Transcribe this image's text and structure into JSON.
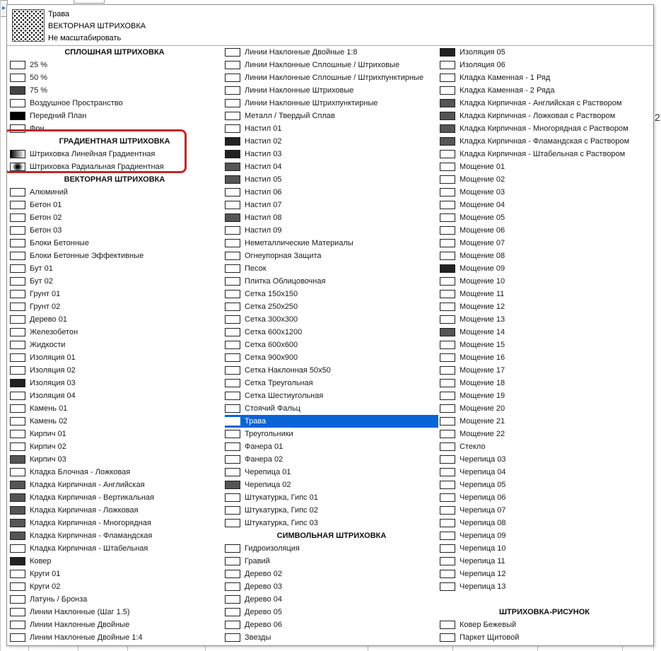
{
  "preview": {
    "name": "Трава",
    "type": "ВЕКТОРНАЯ ШТРИХОВКА",
    "scale": "Не масштабировать"
  },
  "background": {
    "right_edge_number": "2",
    "left_tab_glyph": "▸"
  },
  "highlight_color": "#c0292b",
  "selection_color": "#0a64d6",
  "columns": [
    {
      "items": [
        {
          "kind": "header",
          "label": "СПЛОШНАЯ ШТРИХОВКА"
        },
        {
          "label": "25 %",
          "pattern": "p-25"
        },
        {
          "label": "50 %",
          "pattern": "p-50"
        },
        {
          "label": "75 %",
          "pattern": "p-75"
        },
        {
          "label": "Воздушное Пространство",
          "pattern": "p-empty"
        },
        {
          "label": "Передний План",
          "pattern": "p-solid"
        },
        {
          "label": "Фон",
          "pattern": "p-empty"
        },
        {
          "kind": "header",
          "label": "ГРАДИЕНТНАЯ ШТРИХОВКА"
        },
        {
          "label": "Штриховка Линейная Градиентная",
          "pattern": "p-lingrad"
        },
        {
          "label": "Штриховка Радиальная Градиентная",
          "pattern": "p-radgrad"
        },
        {
          "kind": "header",
          "label": "ВЕКТОРНАЯ ШТРИХОВКА"
        },
        {
          "label": "Алюминий",
          "pattern": "p-diag"
        },
        {
          "label": "Бетон 01",
          "pattern": "p-dots"
        },
        {
          "label": "Бетон 02",
          "pattern": "p-dots"
        },
        {
          "label": "Бетон 03",
          "pattern": "p-star"
        },
        {
          "label": "Блоки Бетонные",
          "pattern": "p-cross"
        },
        {
          "label": "Блоки Бетонные Эффективные",
          "pattern": "p-cross"
        },
        {
          "label": "Бут 01",
          "pattern": "p-wave"
        },
        {
          "label": "Бут 02",
          "pattern": "p-wave"
        },
        {
          "label": "Грунт 01",
          "pattern": "p-diag"
        },
        {
          "label": "Грунт 02",
          "pattern": "p-diag"
        },
        {
          "label": "Дерево 01",
          "pattern": "p-diag2"
        },
        {
          "label": "Железобетон",
          "pattern": "p-diag"
        },
        {
          "label": "Жидкости",
          "pattern": "p-dots"
        },
        {
          "label": "Изоляция 01",
          "pattern": "p-cross"
        },
        {
          "label": "Изоляция 02",
          "pattern": "p-diag"
        },
        {
          "label": "Изоляция 03",
          "pattern": "p-dark"
        },
        {
          "label": "Изоляция 04",
          "pattern": "p-wave"
        },
        {
          "label": "Камень 01",
          "pattern": "p-dots"
        },
        {
          "label": "Камень 02",
          "pattern": "p-dots"
        },
        {
          "label": "Кирпич 01",
          "pattern": "p-diag"
        },
        {
          "label": "Кирпич 02",
          "pattern": "p-diag"
        },
        {
          "label": "Кирпич 03",
          "pattern": "p-brick"
        },
        {
          "label": "Кладка Блочная - Ложковая",
          "pattern": "p-hlines"
        },
        {
          "label": "Кладка Кирпичная - Английская",
          "pattern": "p-brick"
        },
        {
          "label": "Кладка Кирпичная - Вертикальная",
          "pattern": "p-brick"
        },
        {
          "label": "Кладка Кирпичная - Ложковая",
          "pattern": "p-brick"
        },
        {
          "label": "Кладка Кирпичная - Многорядная",
          "pattern": "p-brick"
        },
        {
          "label": "Кладка Кирпичная - Фламандская",
          "pattern": "p-brick"
        },
        {
          "label": "Кладка Кирпичная - Штабельная",
          "pattern": "p-grid"
        },
        {
          "label": "Ковер",
          "pattern": "p-dark"
        },
        {
          "label": "Круги 01",
          "pattern": "p-circles"
        },
        {
          "label": "Круги 02",
          "pattern": "p-check"
        },
        {
          "label": "Латунь / Бронза",
          "pattern": "p-diag"
        },
        {
          "label": "Линии Наклонные (Шаг 1.5)",
          "pattern": "p-diag"
        },
        {
          "label": "Линии Наклонные Двойные",
          "pattern": "p-diag"
        },
        {
          "label": "Линии Наклонные Двойные 1:4",
          "pattern": "p-diag"
        }
      ]
    },
    {
      "items": [
        {
          "label": "Линии Наклонные Двойные 1:8",
          "pattern": "p-diag"
        },
        {
          "label": "Линии Наклонные Сплошные / Штриховые",
          "pattern": "p-diag"
        },
        {
          "label": "Линии Наклонные Сплошные / Штрихпунктирные",
          "pattern": "p-diag"
        },
        {
          "label": "Линии Наклонные Штриховые",
          "pattern": "p-diag"
        },
        {
          "label": "Линии Наклонные Штрихпунктирные",
          "pattern": "p-diag"
        },
        {
          "label": "Металл / Твердый Сплав",
          "pattern": "p-diag"
        },
        {
          "label": "Настил 01",
          "pattern": "p-hlines"
        },
        {
          "label": "Настил 02",
          "pattern": "p-dark"
        },
        {
          "label": "Настил 03",
          "pattern": "p-dark"
        },
        {
          "label": "Настил 04",
          "pattern": "p-brick"
        },
        {
          "label": "Настил 05",
          "pattern": "p-brick"
        },
        {
          "label": "Настил 06",
          "pattern": "p-tile"
        },
        {
          "label": "Настил 07",
          "pattern": "p-check"
        },
        {
          "label": "Настил 08",
          "pattern": "p-brick"
        },
        {
          "label": "Настил 09",
          "pattern": "p-zig"
        },
        {
          "label": "Неметаллические Материалы",
          "pattern": "p-diag"
        },
        {
          "label": "Огнеупорная Защита",
          "pattern": "p-cross"
        },
        {
          "label": "Песок",
          "pattern": "p-dots"
        },
        {
          "label": "Плитка Облицовочная",
          "pattern": "p-dots"
        },
        {
          "label": "Сетка 150x150",
          "pattern": "p-tile"
        },
        {
          "label": "Сетка 250x250",
          "pattern": "p-tile"
        },
        {
          "label": "Сетка 300x300",
          "pattern": "p-tile"
        },
        {
          "label": "Сетка 600x1200",
          "pattern": "p-grid"
        },
        {
          "label": "Сетка 600x600",
          "pattern": "p-tile"
        },
        {
          "label": "Сетка 900x900",
          "pattern": "p-tile"
        },
        {
          "label": "Сетка Наклонная 50x50",
          "pattern": "p-cross"
        },
        {
          "label": "Сетка Треугольная",
          "pattern": "p-zig"
        },
        {
          "label": "Сетка Шестиугольная",
          "pattern": "p-circles"
        },
        {
          "label": "Стоячий Фальц",
          "pattern": "p-diag"
        },
        {
          "label": "Трава",
          "pattern": "p-star",
          "selected": true
        },
        {
          "label": "Треугольники",
          "pattern": "p-zig"
        },
        {
          "label": "Фанера 01",
          "pattern": "p-hlines"
        },
        {
          "label": "Фанера 02",
          "pattern": "p-wave"
        },
        {
          "label": "Черепица 01",
          "pattern": "p-wave"
        },
        {
          "label": "Черепица 02",
          "pattern": "p-brick"
        },
        {
          "label": "Штукатурка, Гипс 01",
          "pattern": "p-dots"
        },
        {
          "label": "Штукатурка, Гипс 02",
          "pattern": "p-dots"
        },
        {
          "label": "Штукатурка, Гипс 03",
          "pattern": "p-dots"
        },
        {
          "kind": "header",
          "label": "СИМВОЛЬНАЯ ШТРИХОВКА"
        },
        {
          "label": "Гидроизоляция",
          "pattern": "p-heavy"
        },
        {
          "label": "Гравий",
          "pattern": "p-circles"
        },
        {
          "label": "Дерево 02",
          "pattern": "p-diag"
        },
        {
          "label": "Дерево 03",
          "pattern": "p-diag"
        },
        {
          "label": "Дерево 04",
          "pattern": "p-wave"
        },
        {
          "label": "Дерево 05",
          "pattern": "p-wave"
        },
        {
          "label": "Дерево 06",
          "pattern": "p-wave"
        },
        {
          "label": "Звезды",
          "pattern": "p-star"
        }
      ]
    },
    {
      "items": [
        {
          "label": "Изоляция 05",
          "pattern": "p-dark"
        },
        {
          "label": "Изоляция 06",
          "pattern": "p-wave"
        },
        {
          "label": "Кладка Каменная - 1 Ряд",
          "pattern": "p-hlines"
        },
        {
          "label": "Кладка Каменная - 2 Ряда",
          "pattern": "p-hlines"
        },
        {
          "label": "Кладка Кирпичная - Английская с Раствором",
          "pattern": "p-brick"
        },
        {
          "label": "Кладка Кирпичная - Ложковая с Раствором",
          "pattern": "p-brick"
        },
        {
          "label": "Кладка Кирпичная - Многорядная с Раствором",
          "pattern": "p-brick"
        },
        {
          "label": "Кладка Кирпичная - Фламандская с Раствором",
          "pattern": "p-brick"
        },
        {
          "label": "Кладка Кирпичная - Штабельная с Раствором",
          "pattern": "p-grid"
        },
        {
          "label": "Мощение 01",
          "pattern": "p-tile"
        },
        {
          "label": "Мощение 02",
          "pattern": "p-tile"
        },
        {
          "label": "Мощение 03",
          "pattern": "p-zig"
        },
        {
          "label": "Мощение 04",
          "pattern": "p-circles"
        },
        {
          "label": "Мощение 05",
          "pattern": "p-tile"
        },
        {
          "label": "Мощение 06",
          "pattern": "p-tile"
        },
        {
          "label": "Мощение 07",
          "pattern": "p-bigcross"
        },
        {
          "label": "Мощение 08",
          "pattern": "p-tile"
        },
        {
          "label": "Мощение 09",
          "pattern": "p-dark"
        },
        {
          "label": "Мощение 10",
          "pattern": "p-check"
        },
        {
          "label": "Мощение 11",
          "pattern": "p-tile"
        },
        {
          "label": "Мощение 12",
          "pattern": "p-tile"
        },
        {
          "label": "Мощение 13",
          "pattern": "p-tile"
        },
        {
          "label": "Мощение 14",
          "pattern": "p-brick"
        },
        {
          "label": "Мощение 15",
          "pattern": "p-bigcross"
        },
        {
          "label": "Мощение 16",
          "pattern": "p-tile"
        },
        {
          "label": "Мощение 17",
          "pattern": "p-vlines"
        },
        {
          "label": "Мощение 18",
          "pattern": "p-wave"
        },
        {
          "label": "Мощение 19",
          "pattern": "p-tile"
        },
        {
          "label": "Мощение 20",
          "pattern": "p-tile"
        },
        {
          "label": "Мощение 21",
          "pattern": "p-check"
        },
        {
          "label": "Мощение 22",
          "pattern": "p-tile"
        },
        {
          "label": "Стекло",
          "pattern": "p-diag"
        },
        {
          "label": "Черепица 03",
          "pattern": "p-bigcross"
        },
        {
          "label": "Черепица 04",
          "pattern": "p-wave"
        },
        {
          "label": "Черепица 05",
          "pattern": "p-zig"
        },
        {
          "label": "Черепица 06",
          "pattern": "p-diag"
        },
        {
          "label": "Черепица 07",
          "pattern": "p-tile"
        },
        {
          "label": "Черепица 08",
          "pattern": "p-tile"
        },
        {
          "label": "Черепица 09",
          "pattern": "p-wave"
        },
        {
          "label": "Черепица 10",
          "pattern": "p-tile"
        },
        {
          "label": "Черепица 11",
          "pattern": "p-tile"
        },
        {
          "label": "Черепица 12",
          "pattern": "p-bigcross"
        },
        {
          "label": "Черепица 13",
          "pattern": "p-heavy"
        },
        {
          "kind": "spacer"
        },
        {
          "kind": "header",
          "label": "ШТРИХОВКА-РИСУНОК"
        },
        {
          "label": "Ковер Бежевый",
          "pattern": "p-tile"
        },
        {
          "label": "Паркет Щитовой",
          "pattern": "p-grid"
        }
      ]
    }
  ]
}
